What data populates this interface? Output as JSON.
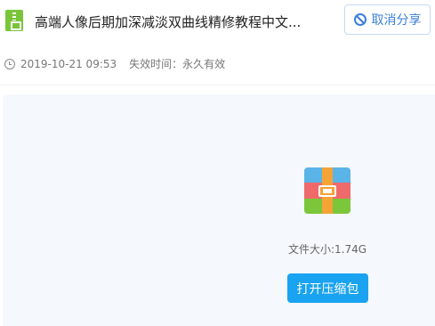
{
  "header": {
    "file_icon": "zip-file-icon",
    "title": "高端人像后期加深减淡双曲线精修教程中文...",
    "cancel_share_label": "取消分享",
    "cancel_icon": "ban-icon"
  },
  "meta": {
    "clock_icon": "clock-icon",
    "date": "2019-10-21 09:53",
    "expiry": "失效时间：永久有效"
  },
  "file_panel": {
    "archive_icon": "archive-icon",
    "size_text": "文件大小:1.74G",
    "open_button_label": "打开压缩包",
    "accent_color": "#1aa3f0"
  }
}
